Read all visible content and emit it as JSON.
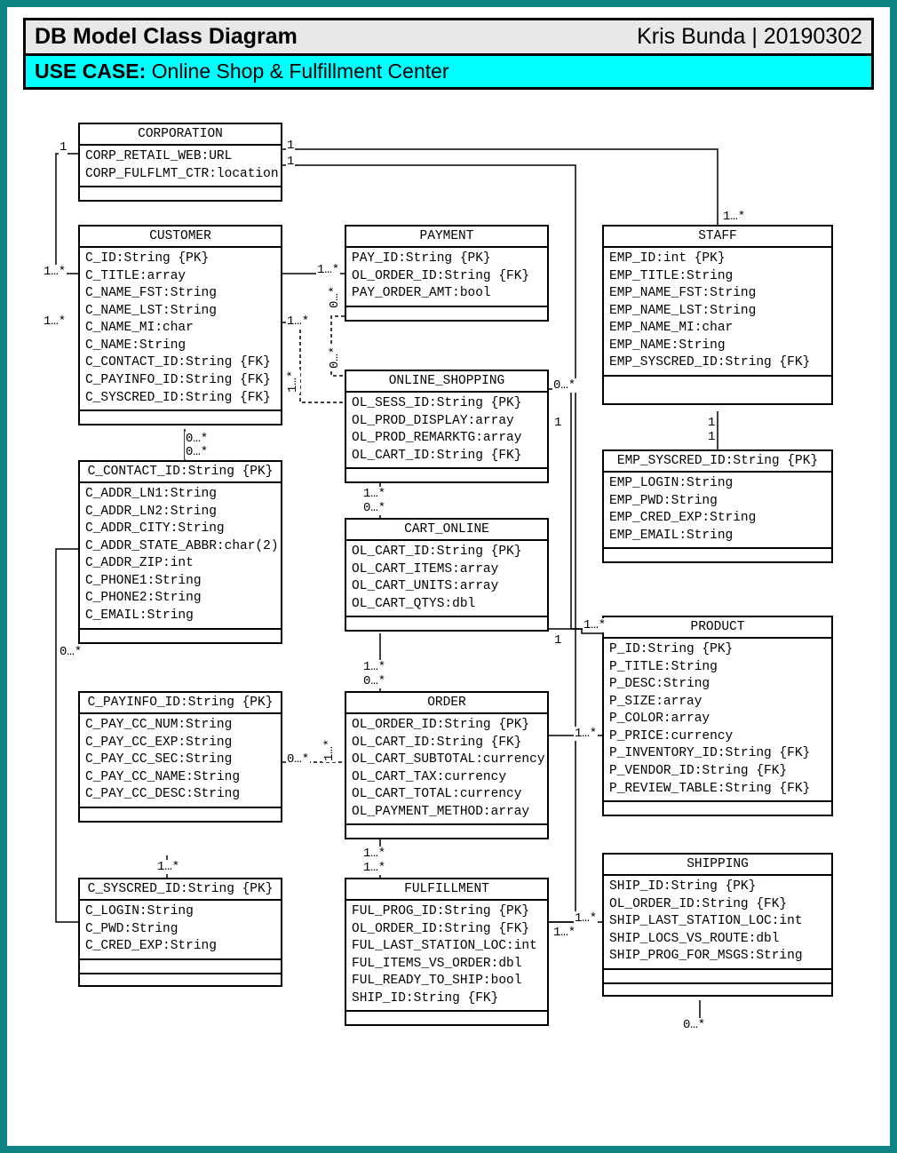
{
  "header": {
    "title": "DB Model Class Diagram",
    "author_date": "Kris Bunda | 20190302",
    "usecase_label": "USE CASE:",
    "usecase_text": "Online Shop & Fulfillment Center"
  },
  "classes": {
    "corporation": {
      "title": "CORPORATION",
      "attrs": [
        "CORP_RETAIL_WEB:URL",
        "CORP_FULFLMT_CTR:location"
      ]
    },
    "customer": {
      "title": "CUSTOMER",
      "attrs": [
        "C_ID:String {PK}",
        "C_TITLE:array",
        "C_NAME_FST:String",
        "C_NAME_LST:String",
        "C_NAME_MI:char",
        "C_NAME:String",
        "C_CONTACT_ID:String {FK}",
        "C_PAYINFO_ID:String {FK}",
        "C_SYSCRED_ID:String {FK}"
      ]
    },
    "c_contact": {
      "title": "C_CONTACT_ID:String {PK}",
      "attrs": [
        "C_ADDR_LN1:String",
        "C_ADDR_LN2:String",
        "C_ADDR_CITY:String",
        "C_ADDR_STATE_ABBR:char(2)",
        "C_ADDR_ZIP:int",
        "C_PHONE1:String",
        "C_PHONE2:String",
        "C_EMAIL:String"
      ]
    },
    "c_payinfo": {
      "title": "C_PAYINFO_ID:String {PK}",
      "attrs": [
        "C_PAY_CC_NUM:String",
        "C_PAY_CC_EXP:String",
        "C_PAY_CC_SEC:String",
        "C_PAY_CC_NAME:String",
        "C_PAY_CC_DESC:String"
      ]
    },
    "c_syscred": {
      "title": "C_SYSCRED_ID:String {PK}",
      "attrs": [
        "C_LOGIN:String",
        "C_PWD:String",
        "C_CRED_EXP:String"
      ]
    },
    "payment": {
      "title": "PAYMENT",
      "attrs": [
        "PAY_ID:String {PK}",
        "OL_ORDER_ID:String {FK}",
        "PAY_ORDER_AMT:bool"
      ]
    },
    "online_shopping": {
      "title": "ONLINE_SHOPPING",
      "attrs": [
        "OL_SESS_ID:String {PK}",
        "OL_PROD_DISPLAY:array",
        "OL_PROD_REMARKTG:array",
        "OL_CART_ID:String {FK}"
      ]
    },
    "cart_online": {
      "title": "CART_ONLINE",
      "attrs": [
        "OL_CART_ID:String {PK}",
        "OL_CART_ITEMS:array",
        "OL_CART_UNITS:array",
        "OL_CART_QTYS:dbl"
      ]
    },
    "order": {
      "title": "ORDER",
      "attrs": [
        "OL_ORDER_ID:String {PK}",
        "OL_CART_ID:String {FK}",
        "OL_CART_SUBTOTAL:currency",
        "OL_CART_TAX:currency",
        "OL_CART_TOTAL:currency",
        "OL_PAYMENT_METHOD:array"
      ]
    },
    "fulfillment": {
      "title": "FULFILLMENT",
      "attrs": [
        "FUL_PROG_ID:String {PK}",
        "OL_ORDER_ID:String {FK}",
        "FUL_LAST_STATION_LOC:int",
        "FUL_ITEMS_VS_ORDER:dbl",
        "FUL_READY_TO_SHIP:bool",
        "SHIP_ID:String {FK}"
      ]
    },
    "staff": {
      "title": "STAFF",
      "attrs": [
        "EMP_ID:int {PK}",
        "EMP_TITLE:String",
        "EMP_NAME_FST:String",
        "EMP_NAME_LST:String",
        "EMP_NAME_MI:char",
        "EMP_NAME:String",
        "EMP_SYSCRED_ID:String {FK}"
      ]
    },
    "emp_syscred": {
      "title": "EMP_SYSCRED_ID:String {PK}",
      "attrs": [
        "EMP_LOGIN:String",
        "EMP_PWD:String",
        "EMP_CRED_EXP:String",
        "EMP_EMAIL:String"
      ]
    },
    "product": {
      "title": "PRODUCT",
      "attrs": [
        "P_ID:String {PK}",
        "P_TITLE:String",
        "P_DESC:String",
        "P_SIZE:array",
        "P_COLOR:array",
        "P_PRICE:currency",
        "P_INVENTORY_ID:String {FK}",
        "P_VENDOR_ID:String {FK}",
        "P_REVIEW_TABLE:String {FK}"
      ]
    },
    "shipping": {
      "title": "SHIPPING",
      "attrs": [
        "SHIP_ID:String {PK}",
        "OL_ORDER_ID:String {FK}",
        "SHIP_LAST_STATION_LOC:int",
        "SHIP_LOCS_VS_ROUTE:dbl",
        "SHIP_PROG_FOR_MSGS:String"
      ]
    }
  },
  "mult": {
    "m1": "1",
    "m1star": "1…*",
    "m0star": "0…*",
    "corp_left_1": "1",
    "corp_right_1a": "1",
    "corp_right_1b": "1",
    "cust_top_left": "1…*",
    "cust_bot_left": "1…*",
    "cust_right": "1…*",
    "cust_below_a": "0…*",
    "cust_below_b": "0…*",
    "contact_left": "0…*",
    "payinfo_right": "0…*",
    "syscred_top": "1…*",
    "pay_left": "1…*",
    "pay_bl_a": "0…*",
    "pay_bl_b": "0…*",
    "ol_side": "1…*",
    "ol_right": "0…*",
    "ol_bl_a": "1…*",
    "ol_bl_b": "0…*",
    "cart_right": "1",
    "cart_bl_a": "1…*",
    "cart_bl_b": "0…*",
    "order_left": "1…*",
    "order_right": "1…*",
    "order_bl_a": "1…*",
    "order_bl_b": "1…*",
    "ful_right_a": "1…*",
    "ful_right_b": "1…*",
    "staff_top": "1…*",
    "staff_bl_a": "1",
    "staff_bl_b": "1",
    "product_top": "1…*",
    "ship_bot": "0…*"
  }
}
